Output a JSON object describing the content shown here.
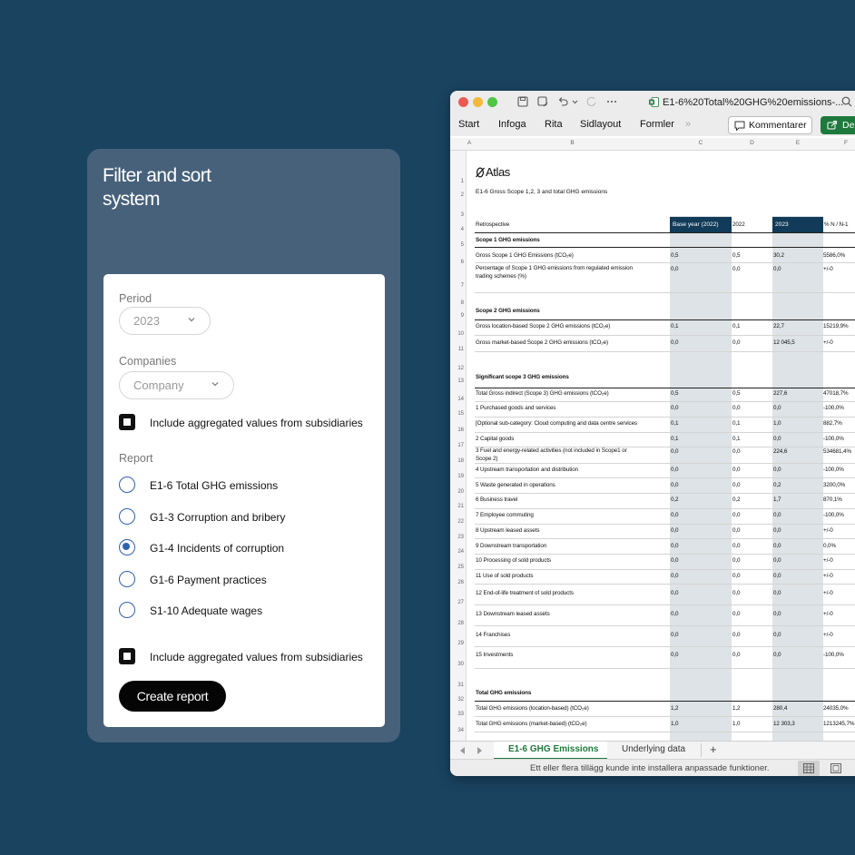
{
  "filter": {
    "title": "Filter and sort\nsystem",
    "period_label": "Period",
    "period_value": "2023",
    "companies_label": "Companies",
    "companies_placeholder": "Company",
    "include_label_1": "Include aggregated values from subsidiaries",
    "report_label": "Report",
    "reports": [
      {
        "label": "E1-6 Total GHG emissions",
        "selected": false
      },
      {
        "label": "G1-3 Corruption and bribery",
        "selected": false
      },
      {
        "label": "G1-4 Incidents of corruption",
        "selected": true
      },
      {
        "label": "G1-6 Payment practices",
        "selected": false
      },
      {
        "label": "S1-10 Adequate wages",
        "selected": false
      }
    ],
    "include_label_2": "Include aggregated values from subsidiaries",
    "create_button": "Create report",
    "accent_color": "#2f62b3"
  },
  "excel": {
    "file_name": "E1-6%20Total%20GHG%20emissions-...",
    "menu": [
      "Start",
      "Infoga",
      "Rita",
      "Sidlayout",
      "Formler",
      "»"
    ],
    "comments_button": "Kommentarer",
    "share_button": "De",
    "columns": [
      "A",
      "B",
      "C",
      "D",
      "E",
      "F"
    ],
    "row_numbers": [
      "1",
      "2",
      "3",
      "4",
      "5",
      "6",
      "7",
      "8",
      "9",
      "10",
      "11",
      "12",
      "13",
      "14",
      "15",
      "16",
      "17",
      "18",
      "19",
      "20",
      "21",
      "22",
      "23",
      "24",
      "25",
      "26",
      "27",
      "28",
      "29",
      "30",
      "31",
      "32",
      "33",
      "34"
    ],
    "brand": "Atlas",
    "subtitle": "E1-6 Gross Scope 1,2, 3 and total GHG emissions",
    "header": {
      "label": "Retrospective",
      "c": "Base year (2022)",
      "d": "2022",
      "e": "2023",
      "f": "% N / N-1"
    },
    "rows": [
      {
        "label": "Scope 1 GHG emissions",
        "bold": true,
        "c": "",
        "d": "",
        "e": "",
        "f": ""
      },
      {
        "label": "Gross Scope 1 GHG Emissions (tCO₂e)",
        "c": "0,5",
        "d": "0,5",
        "e": "30,2",
        "f": "5586,0%"
      },
      {
        "label": "Percentage of Scope 1 GHG emissions from regulated emission",
        "label2": "trading schemes (%)",
        "c": "0,0",
        "d": "0,0",
        "e": "0,0",
        "f": "+/-0"
      },
      {
        "label": "Scope 2 GHG emissions",
        "bold": true,
        "c": "",
        "d": "",
        "e": "",
        "f": ""
      },
      {
        "label": "Gross location-based Scope 2 GHG emissions (tCO₂e)",
        "c": "0,1",
        "d": "0,1",
        "e": "22,7",
        "f": "15219,9%"
      },
      {
        "label": "Gross market-based Scope 2 GHG emissions (tCO₂e)",
        "c": "0,0",
        "d": "0,0",
        "e": "12 045,5",
        "f": "+/-0"
      },
      {
        "label": "Significant scope 3 GHG emissions",
        "bold": true,
        "c": "",
        "d": "",
        "e": "",
        "f": ""
      },
      {
        "label": "Total Gross indirect (Scope 3) GHG emissions (tCO₂e)",
        "c": "0,5",
        "d": "0,5",
        "e": "227,6",
        "f": "47018,7%"
      },
      {
        "label": "1 Purchased goods and services",
        "c": "0,0",
        "d": "0,0",
        "e": "0,0",
        "f": "-100,0%"
      },
      {
        "label": "[Optional sub-category: Cloud computing and data centre services",
        "c": "0,1",
        "d": "0,1",
        "e": "1,0",
        "f": "882,7%"
      },
      {
        "label": "2 Capital goods",
        "c": "0,1",
        "d": "0,1",
        "e": "0,0",
        "f": "-100,0%"
      },
      {
        "label": "3 Fuel and energy-related activities (not included in Scope1 or",
        "label2": "Scope 2)",
        "c": "0,0",
        "d": "0,0",
        "e": "224,6",
        "f": "534681,4%"
      },
      {
        "label": "4 Upstream transportation and distribution",
        "c": "0,0",
        "d": "0,0",
        "e": "0,0",
        "f": "-100,0%"
      },
      {
        "label": "5 Waste generated in operations",
        "c": "0,0",
        "d": "0,0",
        "e": "0,2",
        "f": "3200,0%"
      },
      {
        "label": "6 Business travel",
        "c": "0,2",
        "d": "0,2",
        "e": "1,7",
        "f": "870,1%"
      },
      {
        "label": "7 Employee commuting",
        "c": "0,0",
        "d": "0,0",
        "e": "0,0",
        "f": "-100,0%"
      },
      {
        "label": "8 Upstream leased assets",
        "c": "0,0",
        "d": "0,0",
        "e": "0,0",
        "f": "+/-0"
      },
      {
        "label": "9 Downstream transportation",
        "c": "0,0",
        "d": "0,0",
        "e": "0,0",
        "f": "0,0%"
      },
      {
        "label": "10 Processing of sold products",
        "c": "0,0",
        "d": "0,0",
        "e": "0,0",
        "f": "+/-0"
      },
      {
        "label": "11 Use of sold products",
        "c": "0,0",
        "d": "0,0",
        "e": "0,0",
        "f": "+/-0"
      },
      {
        "label": "12 End-of-life treatment of sold products",
        "c": "0,0",
        "d": "0,0",
        "e": "0,0",
        "f": "+/-0"
      },
      {
        "label": "13 Downstream leased assets",
        "c": "0,0",
        "d": "0,0",
        "e": "0,0",
        "f": "+/-0"
      },
      {
        "label": "14 Franchises",
        "c": "0,0",
        "d": "0,0",
        "e": "0,0",
        "f": "+/-0"
      },
      {
        "label": "15 Investments",
        "c": "0,0",
        "d": "0,0",
        "e": "0,0",
        "f": "-100,0%"
      },
      {
        "label": "Total GHG emissions",
        "bold": true,
        "c": "",
        "d": "",
        "e": "",
        "f": ""
      },
      {
        "label": "Total GHG emissions (location-based) (tCO₂e)",
        "c": "1,2",
        "d": "1,2",
        "e": "280,4",
        "f": "24035,0%"
      },
      {
        "label": "Total GHG emissions (market-based) (tCO₂e)",
        "c": "1,0",
        "d": "1,0",
        "e": "12 303,3",
        "f": "1213245,7%"
      }
    ],
    "tabs": [
      "E1-6 GHG Emissions",
      "Underlying data"
    ],
    "add_tab": "+",
    "status_text": "Ett eller flera tillägg kunde inte installera anpassade funktioner."
  }
}
